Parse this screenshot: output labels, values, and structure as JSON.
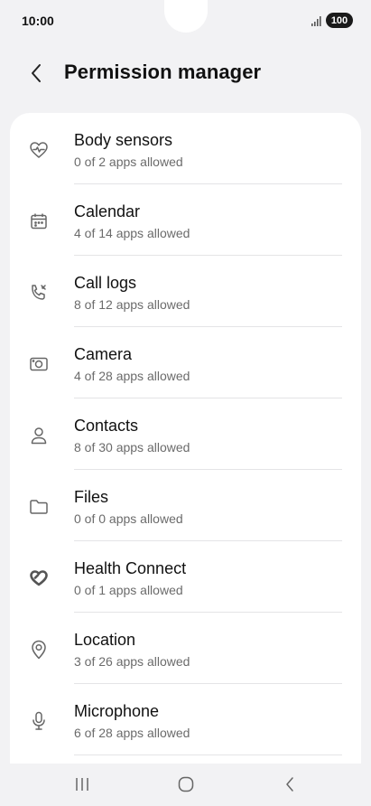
{
  "status": {
    "time": "10:00",
    "battery": "100"
  },
  "header": {
    "title": "Permission manager"
  },
  "permissions": [
    {
      "title": "Body sensors",
      "subtitle": "0 of 2 apps allowed",
      "icon": "heart-pulse-icon"
    },
    {
      "title": "Calendar",
      "subtitle": "4 of 14 apps allowed",
      "icon": "calendar-icon"
    },
    {
      "title": "Call logs",
      "subtitle": "8 of 12 apps allowed",
      "icon": "call-log-icon"
    },
    {
      "title": "Camera",
      "subtitle": "4 of 28 apps allowed",
      "icon": "camera-icon"
    },
    {
      "title": "Contacts",
      "subtitle": "8 of 30 apps allowed",
      "icon": "person-icon"
    },
    {
      "title": "Files",
      "subtitle": "0 of 0 apps allowed",
      "icon": "folder-icon"
    },
    {
      "title": "Health Connect",
      "subtitle": "0 of 1 apps allowed",
      "icon": "health-connect-icon"
    },
    {
      "title": "Location",
      "subtitle": "3 of 26 apps allowed",
      "icon": "location-pin-icon"
    },
    {
      "title": "Microphone",
      "subtitle": "6 of 28 apps allowed",
      "icon": "microphone-icon"
    }
  ]
}
